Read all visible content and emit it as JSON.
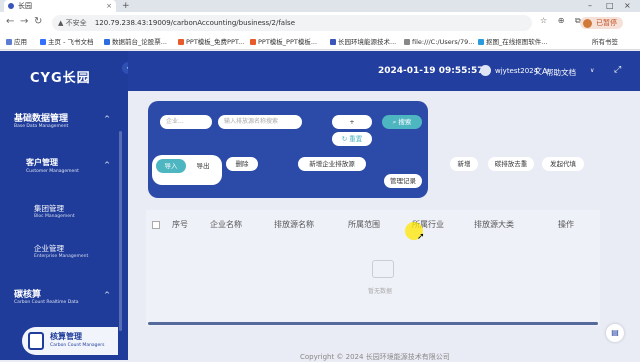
{
  "browser": {
    "tab_title": "长园",
    "tab_close": "×",
    "new_tab": "+",
    "window_controls": [
      "–",
      "□",
      "×"
    ],
    "nav": [
      "←",
      "→",
      "↻"
    ],
    "security_warning": "▲ 不安全",
    "url": "120.79.238.43:19009/carbonAccounting/business/2/false",
    "paused_label": "已暂停",
    "bookmarks": [
      {
        "label": "应用",
        "color": "#5b7bd5"
      },
      {
        "label": "主页 - 飞书文档",
        "color": "#3370ff"
      },
      {
        "label": "数据前台_论股票...",
        "color": "#2b6de0"
      },
      {
        "label": "PPT模板_免费PPT...",
        "color": "#e85a2a"
      },
      {
        "label": "PPT模板_PPT模板...",
        "color": "#e85a2a"
      },
      {
        "label": "长园环境能源技术...",
        "color": "#3a56b8"
      },
      {
        "label": "file:///C:/Users/79...",
        "color": "#888888"
      },
      {
        "label": "抠图_在线抠图软件...",
        "color": "#2b9be0"
      }
    ],
    "bookmarks_all": "所有书签"
  },
  "sidebar": {
    "logo": "CYG长园",
    "collapse": "‹",
    "sections": [
      {
        "title": "基础数据管理",
        "subtitle": "Base Data Management",
        "chevron": "^"
      },
      {
        "title": "客户管理",
        "subtitle": "Customer Management",
        "chevron": "^"
      },
      {
        "title": "集团管理",
        "subtitle": "Bloc Management"
      },
      {
        "title": "企业管理",
        "subtitle": "Enterprise Management"
      },
      {
        "title": "碳核算",
        "subtitle": "Carbon Count Realtime Data",
        "chevron": "^"
      }
    ],
    "active": {
      "title": "核算管理",
      "subtitle": "Carbon Count Managers"
    }
  },
  "header": {
    "datetime": "2024-01-19 09:55:57",
    "username": "wjytest2024",
    "lang_icon": "文A",
    "help": "帮助文档",
    "help_chevron": "∨",
    "expand_icon": "⤢"
  },
  "filters": {
    "enterprise_placeholder": "企业...",
    "keyword_placeholder": "输入排放源名称搜索",
    "add_label": "+",
    "search_label": "搜索",
    "reset_label": "重置",
    "import_label": "导入",
    "export_label": "导出",
    "delete_label": "删除",
    "actions": [
      "新增企业排放源",
      "新增",
      "碳排放去重",
      "发起代填",
      "管理记录"
    ]
  },
  "table": {
    "columns": [
      "序号",
      "企业名称",
      "排放源名称",
      "所属范围",
      "所属行业",
      "排放源大类",
      "操作"
    ],
    "empty_text": "暂无数据"
  },
  "footer": {
    "copyright": "Copyright © 2024 长园环境能源技术有限公司"
  },
  "fab_icon": "▤",
  "colors": {
    "primary": "#1f3c9b",
    "accent": "#4db6c1"
  }
}
